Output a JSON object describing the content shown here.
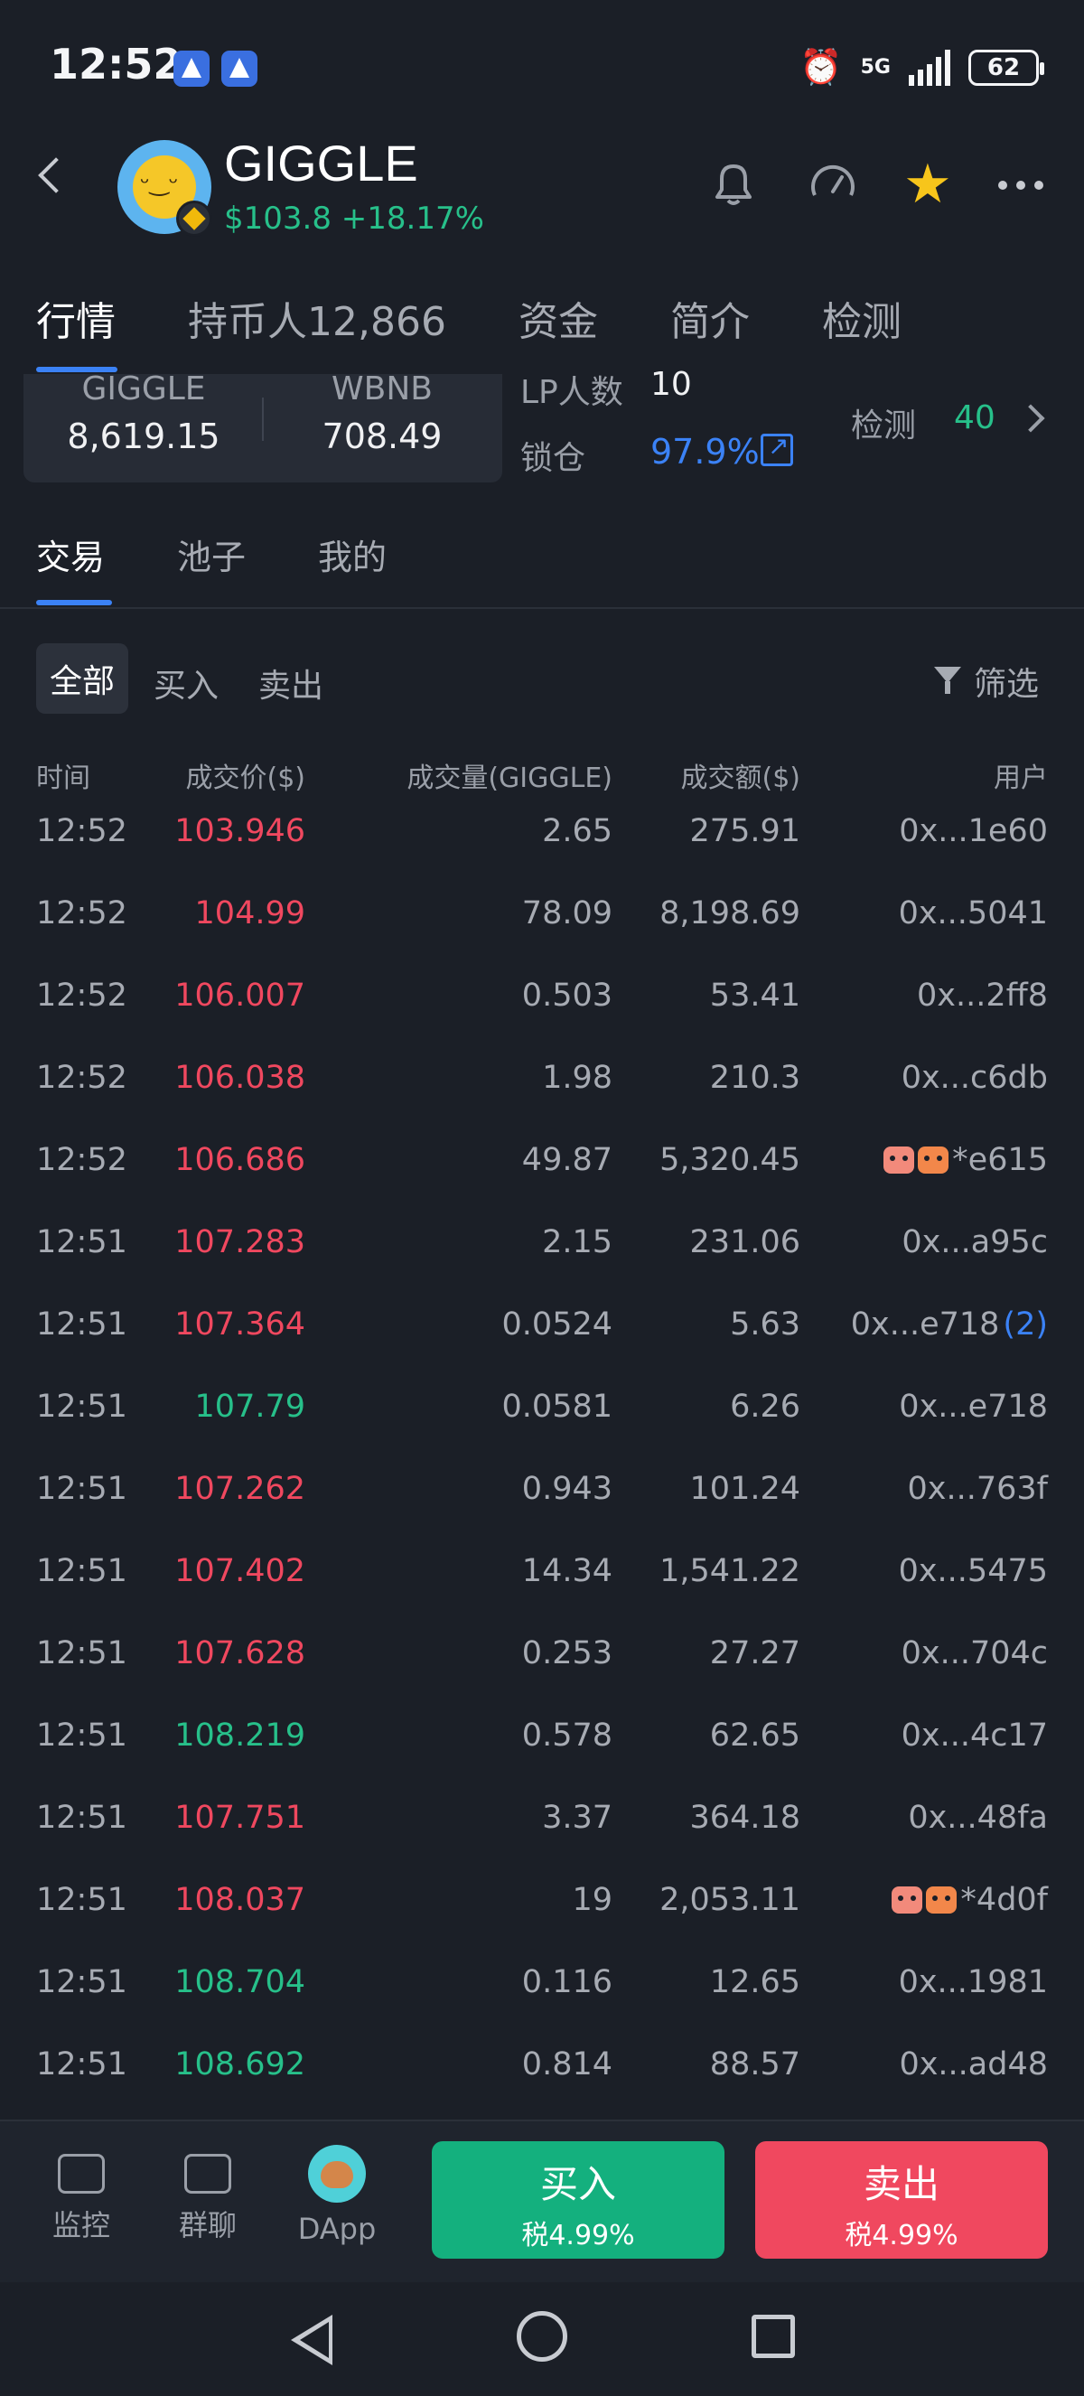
{
  "status_bar": {
    "time": "12:52",
    "network": "5G",
    "battery": "62"
  },
  "header": {
    "token_name": "GIGGLE",
    "price_change": "$103.8 +18.17%"
  },
  "main_tabs": [
    {
      "label": "行情"
    },
    {
      "label": "持币人12,866"
    },
    {
      "label": "资金"
    },
    {
      "label": "简介"
    },
    {
      "label": "检测"
    }
  ],
  "pool": {
    "token_a_label": "GIGGLE",
    "token_a_amount": "8,619.15",
    "token_b_label": "WBNB",
    "token_b_amount": "708.49",
    "lp_holders_label": "LP人数",
    "lp_holders_value": "10",
    "lock_label": "锁仓",
    "lock_value": "97.9%",
    "check_label": "检测",
    "check_value": "40"
  },
  "sub_tabs": [
    {
      "label": "交易"
    },
    {
      "label": "池子"
    },
    {
      "label": "我的"
    }
  ],
  "filters": {
    "all": "全部",
    "buy": "买入",
    "sell": "卖出",
    "filter": "筛选"
  },
  "table": {
    "headers": {
      "time": "时间",
      "price": "成交价($)",
      "amount": "成交量(GIGGLE)",
      "value": "成交额($)",
      "user": "用户"
    },
    "rows": [
      {
        "time": "12:52",
        "price": "103.946",
        "amount": "2.65",
        "value": "275.91",
        "user": "0x...1e60",
        "side": "up"
      },
      {
        "time": "12:52",
        "price": "104.99",
        "amount": "78.09",
        "value": "8,198.69",
        "user": "0x...5041",
        "side": "up"
      },
      {
        "time": "12:52",
        "price": "106.007",
        "amount": "0.503",
        "value": "53.41",
        "user": "0x...2ff8",
        "side": "up"
      },
      {
        "time": "12:52",
        "price": "106.038",
        "amount": "1.98",
        "value": "210.3",
        "user": "0x...c6db",
        "side": "up"
      },
      {
        "time": "12:52",
        "price": "106.686",
        "amount": "49.87",
        "value": "5,320.45",
        "user": "*e615",
        "side": "up",
        "bot": true
      },
      {
        "time": "12:51",
        "price": "107.283",
        "amount": "2.15",
        "value": "231.06",
        "user": "0x...a95c",
        "side": "up"
      },
      {
        "time": "12:51",
        "price": "107.364",
        "amount": "0.0524",
        "value": "5.63",
        "user": "0x...e718",
        "count": "(2)",
        "side": "up"
      },
      {
        "time": "12:51",
        "price": "107.79",
        "amount": "0.0581",
        "value": "6.26",
        "user": "0x...e718",
        "side": "down"
      },
      {
        "time": "12:51",
        "price": "107.262",
        "amount": "0.943",
        "value": "101.24",
        "user": "0x...763f",
        "side": "up"
      },
      {
        "time": "12:51",
        "price": "107.402",
        "amount": "14.34",
        "value": "1,541.22",
        "user": "0x...5475",
        "side": "up"
      },
      {
        "time": "12:51",
        "price": "107.628",
        "amount": "0.253",
        "value": "27.27",
        "user": "0x...704c",
        "side": "up"
      },
      {
        "time": "12:51",
        "price": "108.219",
        "amount": "0.578",
        "value": "62.65",
        "user": "0x...4c17",
        "side": "down"
      },
      {
        "time": "12:51",
        "price": "107.751",
        "amount": "3.37",
        "value": "364.18",
        "user": "0x...48fa",
        "side": "up"
      },
      {
        "time": "12:51",
        "price": "108.037",
        "amount": "19",
        "value": "2,053.11",
        "user": "*4d0f",
        "side": "up",
        "bot": true
      },
      {
        "time": "12:51",
        "price": "108.704",
        "amount": "0.116",
        "value": "12.65",
        "user": "0x...1981",
        "side": "down"
      },
      {
        "time": "12:51",
        "price": "108.692",
        "amount": "0.814",
        "value": "88.57",
        "user": "0x...ad48",
        "side": "down"
      }
    ]
  },
  "bottom_nav": {
    "monitor": "监控",
    "group_chat": "群聊",
    "dapp": "DApp",
    "buy_label": "买入",
    "buy_tax": "税4.99%",
    "sell_label": "卖出",
    "sell_tax": "税4.99%"
  },
  "colors": {
    "up": "#f0485f",
    "down": "#27c08a",
    "accent": "#3b82f6",
    "background": "#1b1f27"
  }
}
